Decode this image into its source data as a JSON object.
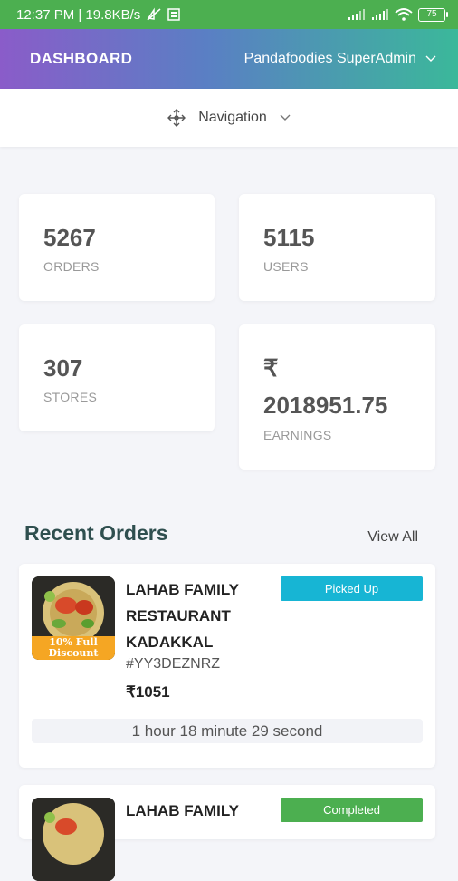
{
  "status_bar": {
    "time_speed": "12:37 PM | 19.8KB/s",
    "battery": "75",
    "icons": [
      "mute-icon",
      "notification-icon",
      "signal-icon",
      "signal-icon",
      "wifi-icon",
      "battery-icon"
    ]
  },
  "header": {
    "title": "DASHBOARD",
    "user": "Pandafoodies SuperAdmin"
  },
  "nav": {
    "label": "Navigation",
    "icon": "move-icon"
  },
  "stats": [
    {
      "value": "5267",
      "label": "ORDERS"
    },
    {
      "value": "5115",
      "label": "USERS"
    },
    {
      "value": "307",
      "label": "STORES"
    },
    {
      "currency": "₹",
      "value": "2018951.75",
      "label": "EARNINGS"
    }
  ],
  "recent_orders": {
    "title": "Recent Orders",
    "view_all": "View All",
    "orders": [
      {
        "name_lines": [
          "LAHAB FAMILY",
          "RESTAURANT",
          "KADAKKAL"
        ],
        "code": "#YY3DEZNRZ",
        "price": "₹1051",
        "status": "Picked Up",
        "status_color": "#17b5d4",
        "elapsed": "1 hour 18 minute 29 second",
        "thumb_text": [
          "10% Full",
          "Discount"
        ]
      },
      {
        "name_lines": [
          "LAHAB FAMILY"
        ],
        "status": "Completed",
        "status_color": "#4caf50"
      }
    ]
  },
  "colors": {
    "status_bar": "#4caf50",
    "picked_up": "#17b5d4",
    "completed": "#4caf50",
    "heading": "#2f4f4f"
  }
}
